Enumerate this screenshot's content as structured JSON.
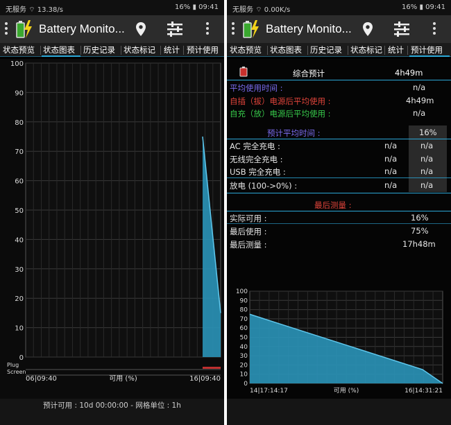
{
  "status": {
    "left_carrier": "无服务",
    "left_speed": "13.38/s",
    "right_speed": "0.00K/s",
    "battery": "16%",
    "time": "09:41"
  },
  "app": {
    "title": "Battery Monito...",
    "title_left": "Battery Monito..."
  },
  "tabs": [
    "状态预览",
    "状态图表",
    "历史记录",
    "状态标记",
    "统计",
    "预计使用"
  ],
  "left_chart": {
    "y_ticks": [
      "100",
      "90",
      "80",
      "70",
      "60",
      "50",
      "40",
      "30",
      "20",
      "10",
      "0"
    ],
    "x_start": "06|09:40",
    "x_end": "16|09:40",
    "x_label": "可用 (%)",
    "plug_label": "Plug",
    "screen_label": "Screen"
  },
  "left_footer": {
    "text": "预计可用 :  10d 00:00:00 - 网格单位 :  1h"
  },
  "estimate": {
    "combined_label": "综合预计",
    "combined_value": "4h49m",
    "avg_use_label": "平均使用时间 :",
    "avg_use_value": "n/a",
    "plugged_label": "自插（拔）电源后平均使用 :",
    "plugged_value": "4h49m",
    "charged_label": "自充（放）电源后平均使用 :",
    "charged_value": "n/a",
    "pred_avg_label": "预计平均时间 :",
    "pred_avg_value": "16%",
    "ac_label": "AC 完全充电 :",
    "ac_v1": "n/a",
    "ac_v2": "n/a",
    "wireless_label": "无线完全充电 :",
    "wireless_v1": "n/a",
    "wireless_v2": "n/a",
    "usb_label": "USB 完全充电 :",
    "usb_v1": "n/a",
    "usb_v2": "n/a",
    "discharge_label": "放电 (100->0%) :",
    "discharge_v1": "n/a",
    "discharge_v2": "n/a",
    "last_measure_header": "最后测量 :",
    "actual_label": "实际可用 :",
    "actual_value": "16%",
    "last_use_label": "最后使用 :",
    "last_use_value": "75%",
    "last_measure_label": "最后测量 :",
    "last_measure_value": "17h48m"
  },
  "right_chart": {
    "y_ticks": [
      "100",
      "90",
      "80",
      "70",
      "60",
      "50",
      "40",
      "30",
      "20",
      "10",
      "0"
    ],
    "x_start": "14|17:14:17",
    "x_end": "16|14:31:21",
    "x_label": "可用 (%)"
  },
  "chart_data": [
    {
      "type": "area",
      "title": "",
      "xlabel": "可用 (%)",
      "ylabel": "",
      "ylim": [
        0,
        100
      ],
      "x_range": [
        "06|09:40",
        "16|09:40"
      ],
      "series": [
        {
          "values": [
            {
              "x": "drop start",
              "y": 75
            },
            {
              "x": "end",
              "y": 15
            }
          ]
        }
      ],
      "grid": true
    },
    {
      "type": "area",
      "title": "",
      "xlabel": "可用 (%)",
      "ylabel": "",
      "ylim": [
        0,
        100
      ],
      "x_range": [
        "14|17:14:17",
        "16|14:31:21"
      ],
      "series": [
        {
          "values": [
            {
              "x": "14|17:14:17",
              "y": 75
            },
            {
              "x": "late",
              "y": 15
            },
            {
              "x": "16|14:31:21",
              "y": 0
            }
          ]
        }
      ],
      "grid": true
    }
  ],
  "colors": {
    "accent": "#2ba8d8",
    "area": "#2a94b8",
    "purple_text": "#7b6cf0",
    "red_text": "#e0443a",
    "green_text": "#37c94a"
  }
}
